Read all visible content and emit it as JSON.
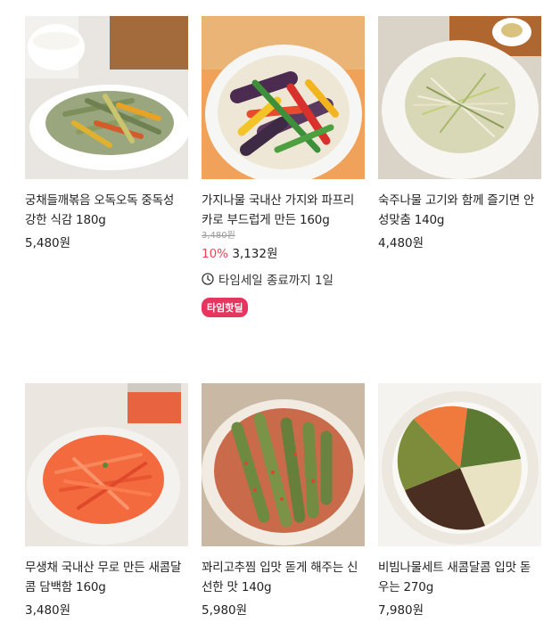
{
  "products": [
    {
      "name": "궁채들깨볶음 오독오독 중독성 강한 식감 180g",
      "price": "5,480원"
    },
    {
      "name": "가지나물 국내산 가지와 파프리카로 부드럽게 만든 160g",
      "original_price": "3,480원",
      "discount": "10%",
      "price": "3,132원",
      "timer_text": "타임세일 종료까지 1일",
      "badge": "타임핫딜"
    },
    {
      "name": "숙주나물 고기와 함께 즐기면 안성맞춤 140g",
      "price": "4,480원"
    },
    {
      "name": "무생채 국내산 무로 만든 새콤달콤 담백함 160g",
      "price": "3,480원"
    },
    {
      "name": "꽈리고추찜 입맛 돋게 해주는 신선한 맛 140g",
      "price": "5,980원"
    },
    {
      "name": "비빔나물세트 새콤달콤 입맛 돋우는 270g",
      "price": "7,980원"
    }
  ]
}
